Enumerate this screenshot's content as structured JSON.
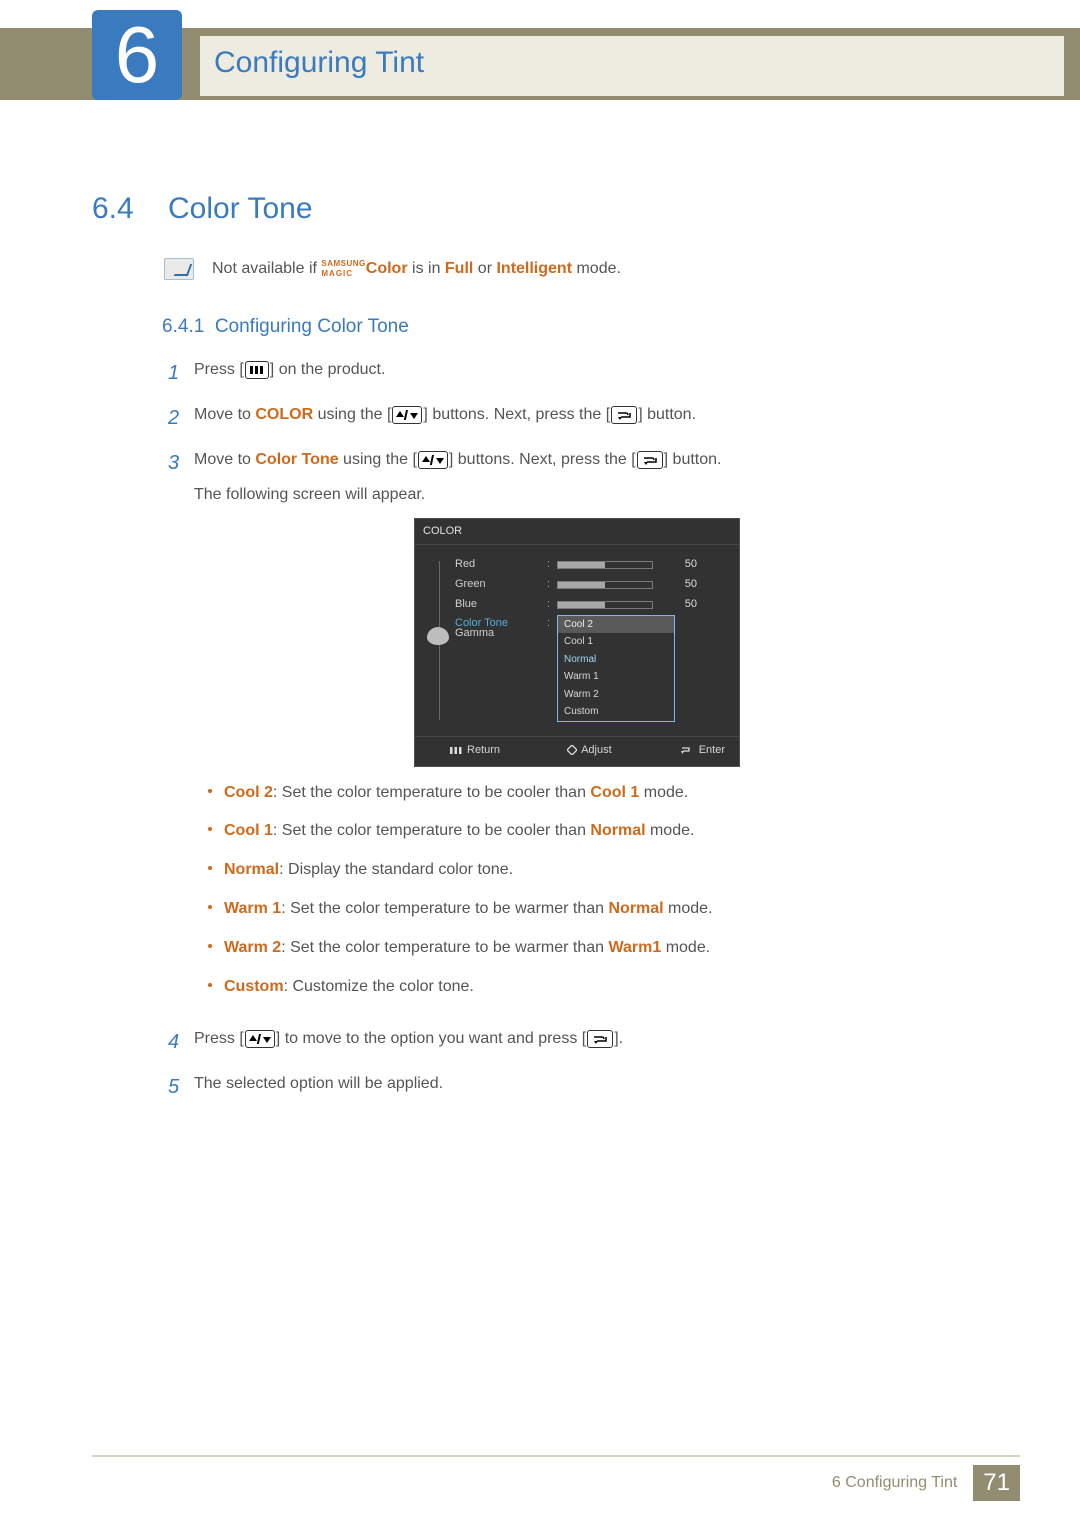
{
  "header": {
    "chapter_num": "6",
    "chapter_title": "Configuring Tint"
  },
  "section": {
    "num": "6.4",
    "title": "Color Tone"
  },
  "note": {
    "prefix": "Not available if ",
    "magic_top": "SAMSUNG",
    "magic_bottom": "MAGIC",
    "magic_word": "Color",
    "mid1": " is in ",
    "full": "Full",
    "mid2": " or ",
    "intelligent": "Intelligent",
    "suffix": " mode."
  },
  "subsection": {
    "num": "6.4.1",
    "title": "Configuring Color Tone"
  },
  "steps": {
    "s1": {
      "num": "1",
      "a": "Press [",
      "b": "] on the product."
    },
    "s2": {
      "num": "2",
      "a": "Move to ",
      "kw": "COLOR",
      "b": " using the [",
      "c": "] buttons. Next, press the [",
      "d": "] button."
    },
    "s3": {
      "num": "3",
      "a": "Move to ",
      "kw": "Color Tone",
      "b": " using the [",
      "c": "] buttons. Next, press the [",
      "d": "] button.",
      "e": "The following screen will appear."
    },
    "s4": {
      "num": "4",
      "a": "Press [",
      "b": "] to move to the option you want and press [",
      "c": "]."
    },
    "s5": {
      "num": "5",
      "a": "The selected option will be applied."
    }
  },
  "osd": {
    "title": "COLOR",
    "rows": {
      "red": {
        "label": "Red",
        "val": "50",
        "pct": 50
      },
      "green": {
        "label": "Green",
        "val": "50",
        "pct": 50
      },
      "blue": {
        "label": "Blue",
        "val": "50",
        "pct": 50
      }
    },
    "color_tone_label": "Color Tone",
    "gamma_label": "Gamma",
    "options": [
      "Cool 2",
      "Cool 1",
      "Normal",
      "Warm 1",
      "Warm 2",
      "Custom"
    ],
    "selected_option_index": 0,
    "hi_option_index": 2,
    "footer": {
      "return": "Return",
      "adjust": "Adjust",
      "enter": "Enter"
    }
  },
  "opts": {
    "cool2": {
      "name": "Cool 2",
      "desc_a": ": Set the color temperature to be cooler than ",
      "ref": "Cool 1",
      "desc_b": " mode."
    },
    "cool1": {
      "name": "Cool 1",
      "desc_a": ": Set the color temperature to be cooler than ",
      "ref": "Normal",
      "desc_b": " mode."
    },
    "normal": {
      "name": "Normal",
      "desc": ": Display the standard color tone."
    },
    "warm1": {
      "name": "Warm 1",
      "desc_a": ": Set the color temperature to be warmer than ",
      "ref": "Normal",
      "desc_b": " mode."
    },
    "warm2": {
      "name": "Warm 2",
      "desc_a": ": Set the color temperature to be warmer than ",
      "ref": "Warm1",
      "desc_b": " mode."
    },
    "custom": {
      "name": "Custom",
      "desc": ": Customize the color tone."
    }
  },
  "footer": {
    "text": "6 Configuring Tint",
    "page": "71"
  }
}
